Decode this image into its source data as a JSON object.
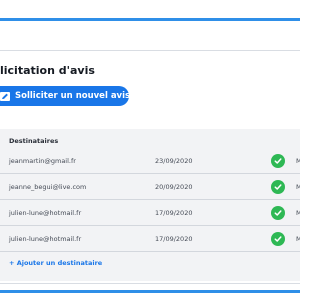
{
  "page": {
    "title": "licitation d'avis",
    "primary_button_label": "Solliciter un nouvel avis"
  },
  "table": {
    "header": "Destinataires",
    "rows": [
      {
        "email": "jeanmartin@gmail.fr",
        "date": "23/09/2020",
        "status": "M"
      },
      {
        "email": "jeanne_begui@live.com",
        "date": "20/09/2020",
        "status": "M"
      },
      {
        "email": "julien-lune@hotmail.fr",
        "date": "17/09/2020",
        "status": "M"
      },
      {
        "email": "julien-lune@hotmail.fr",
        "date": "17/09/2020",
        "status": "M"
      }
    ],
    "add_link": "+ Ajouter un destinataire"
  },
  "colors": {
    "accent": "#1976e8",
    "top_border": "#2f8fe8",
    "success": "#2eb854",
    "table_bg": "#f2f3f5"
  }
}
